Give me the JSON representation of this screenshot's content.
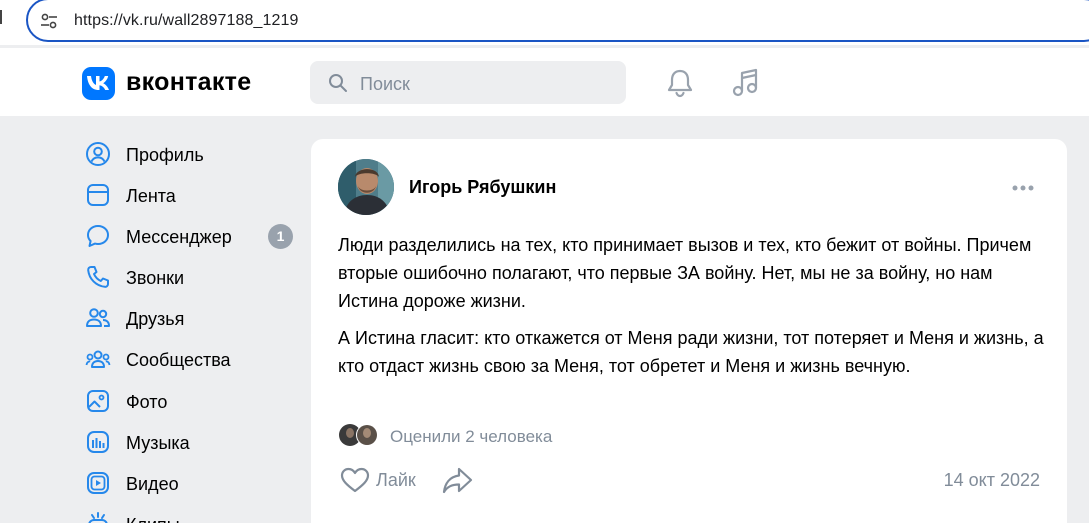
{
  "browser": {
    "url": "https://vk.ru/wall2897188_1219"
  },
  "header": {
    "logo_text": "вконтакте",
    "search_placeholder": "Поиск"
  },
  "sidebar": {
    "items": [
      {
        "label": "Профиль",
        "icon": "profile-icon"
      },
      {
        "label": "Лента",
        "icon": "feed-icon"
      },
      {
        "label": "Мессенджер",
        "icon": "messenger-icon",
        "badge": "1"
      },
      {
        "label": "Звонки",
        "icon": "phone-icon"
      },
      {
        "label": "Друзья",
        "icon": "friends-icon"
      },
      {
        "label": "Сообщества",
        "icon": "communities-icon"
      },
      {
        "label": "Фото",
        "icon": "photo-icon"
      },
      {
        "label": "Музыка",
        "icon": "music-icon"
      },
      {
        "label": "Видео",
        "icon": "video-icon"
      },
      {
        "label": "Клипы",
        "icon": "clips-icon"
      }
    ]
  },
  "post": {
    "author": "Игорь Рябушкин",
    "paragraphs": [
      "Люди разделились на тех, кто принимает вызов и тех, кто бежит от войны. Причем вторые ошибочно полагают, что первые ЗА войну. Нет, мы не за войну, но нам Истина дороже жизни.",
      "А Истина гласит: кто откажется от Меня ради жизни, тот потеряет и Меня и жизнь, а кто отдаст жизнь свою за Меня, тот обретет и Меня и жизнь вечную."
    ],
    "liked_by": "Оценили 2 человека",
    "like_label": "Лайк",
    "date": "14 окт 2022"
  },
  "colors": {
    "brand": "#0077ff",
    "background": "#edeef0",
    "secondary_text": "#818c99",
    "icon": "#2688eb"
  }
}
